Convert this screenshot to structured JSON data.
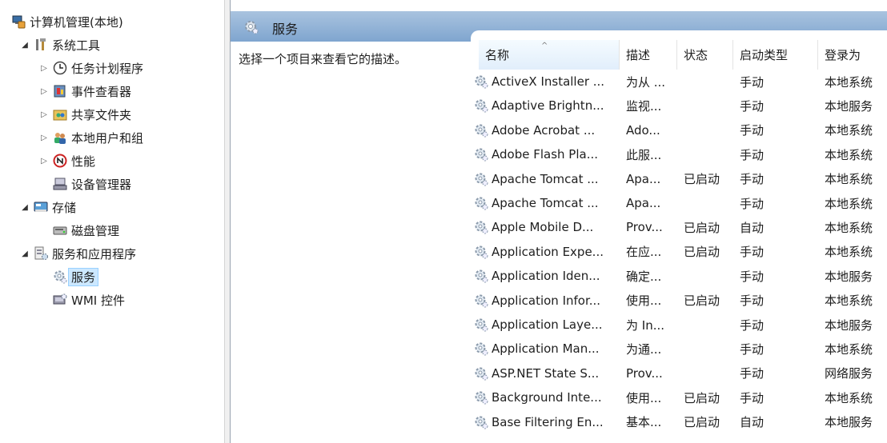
{
  "tree": {
    "root": {
      "label": "计算机管理(本地)",
      "icon": "computer-management-icon"
    },
    "items": [
      {
        "label": "系统工具",
        "icon": "tools-icon",
        "twisty": "open"
      },
      {
        "label": "任务计划程序",
        "icon": "clock-icon",
        "twisty": "closed"
      },
      {
        "label": "事件查看器",
        "icon": "event-viewer-icon",
        "twisty": "closed"
      },
      {
        "label": "共享文件夹",
        "icon": "shared-folder-icon",
        "twisty": "closed"
      },
      {
        "label": "本地用户和组",
        "icon": "users-icon",
        "twisty": "closed"
      },
      {
        "label": "性能",
        "icon": "performance-icon",
        "twisty": "closed"
      },
      {
        "label": "设备管理器",
        "icon": "device-manager-icon",
        "twisty": "none"
      },
      {
        "label": "存储",
        "icon": "storage-icon",
        "twisty": "open"
      },
      {
        "label": "磁盘管理",
        "icon": "disk-icon",
        "twisty": "none"
      },
      {
        "label": "服务和应用程序",
        "icon": "services-apps-icon",
        "twisty": "open"
      },
      {
        "label": "服务",
        "icon": "services-gear-icon",
        "twisty": "none",
        "selected": true
      },
      {
        "label": "WMI 控件",
        "icon": "wmi-icon",
        "twisty": "none"
      }
    ]
  },
  "panel": {
    "title": "服务",
    "description": "选择一个项目来查看它的描述。"
  },
  "table": {
    "columns": [
      "名称",
      "描述",
      "状态",
      "启动类型",
      "登录为"
    ],
    "rows": [
      [
        "ActiveX Installer ...",
        "为从 ...",
        "",
        "手动",
        "本地系统"
      ],
      [
        "Adaptive Brightn...",
        "监视...",
        "",
        "手动",
        "本地服务"
      ],
      [
        "Adobe Acrobat ...",
        "Ado...",
        "",
        "手动",
        "本地系统"
      ],
      [
        "Adobe Flash Pla...",
        "此服...",
        "",
        "手动",
        "本地系统"
      ],
      [
        "Apache Tomcat ...",
        "Apa...",
        "已启动",
        "手动",
        "本地系统"
      ],
      [
        "Apache Tomcat ...",
        "Apa...",
        "",
        "手动",
        "本地系统"
      ],
      [
        "Apple Mobile D...",
        "Prov...",
        "已启动",
        "自动",
        "本地系统"
      ],
      [
        "Application Expe...",
        "在应...",
        "已启动",
        "手动",
        "本地系统"
      ],
      [
        "Application Iden...",
        "确定...",
        "",
        "手动",
        "本地服务"
      ],
      [
        "Application Infor...",
        "使用...",
        "已启动",
        "手动",
        "本地系统"
      ],
      [
        "Application Laye...",
        "为 In...",
        "",
        "手动",
        "本地服务"
      ],
      [
        "Application Man...",
        "为通...",
        "",
        "手动",
        "本地系统"
      ],
      [
        "ASP.NET State S...",
        "Prov...",
        "",
        "手动",
        "网络服务"
      ],
      [
        "Background Inte...",
        "使用...",
        "已启动",
        "手动",
        "本地系统"
      ],
      [
        "Base Filtering En...",
        "基本...",
        "已启动",
        "自动",
        "本地服务"
      ]
    ]
  },
  "colors": {
    "header_top": "#a9c3df",
    "header_bottom": "#7fa5cf",
    "selection": "#cce8ff"
  }
}
